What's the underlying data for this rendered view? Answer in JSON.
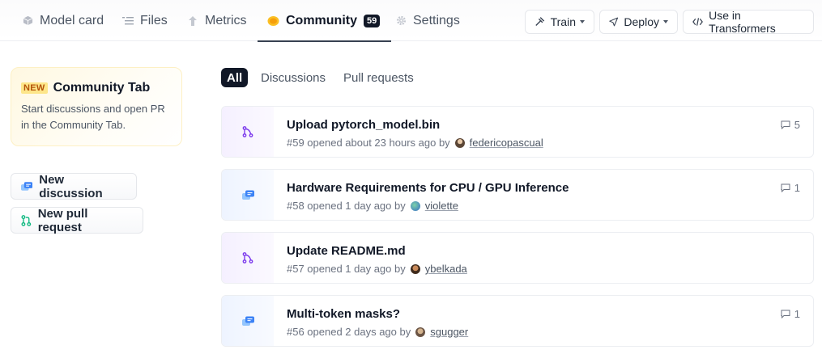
{
  "tabs": [
    {
      "label": "Model card",
      "icon": "model-card-icon"
    },
    {
      "label": "Files",
      "icon": "files-icon"
    },
    {
      "label": "Metrics",
      "icon": "metrics-icon"
    },
    {
      "label": "Community",
      "icon": "community-icon",
      "badge": "59",
      "active": true
    },
    {
      "label": "Settings",
      "icon": "gear-icon"
    }
  ],
  "actions": {
    "train": "Train",
    "deploy": "Deploy",
    "use_in_transformers": "Use in Transformers"
  },
  "promo": {
    "badge": "NEW",
    "title": "Community Tab",
    "text": "Start discussions and open PR in the Community Tab."
  },
  "side_buttons": {
    "new_discussion": "New discussion",
    "new_pull_request": "New pull request"
  },
  "filters": [
    "All",
    "Discussions",
    "Pull requests"
  ],
  "active_filter": "All",
  "discussions": [
    {
      "type": "pull-request",
      "title": "Upload pytorch_model.bin",
      "meta": "#59 opened about 23 hours ago by",
      "author": "federicopascual",
      "comments": "5"
    },
    {
      "type": "discussion",
      "title": "Hardware Requirements for CPU / GPU Inference",
      "meta": "#58 opened 1 day ago by",
      "author": "violette",
      "comments": "1"
    },
    {
      "type": "pull-request",
      "title": "Update README.md",
      "meta": "#57 opened 1 day ago by",
      "author": "ybelkada",
      "comments": ""
    },
    {
      "type": "discussion",
      "title": "Multi-token masks?",
      "meta": "#56 opened 2 days ago by",
      "author": "sgugger",
      "comments": "1"
    }
  ],
  "colors": {
    "pr_icon": "#7c3aed",
    "discussion_icon": "#3b82f6",
    "active_text": "#111827",
    "promo_background": "#fff8e1",
    "new_badge_background": "#fde68a"
  }
}
